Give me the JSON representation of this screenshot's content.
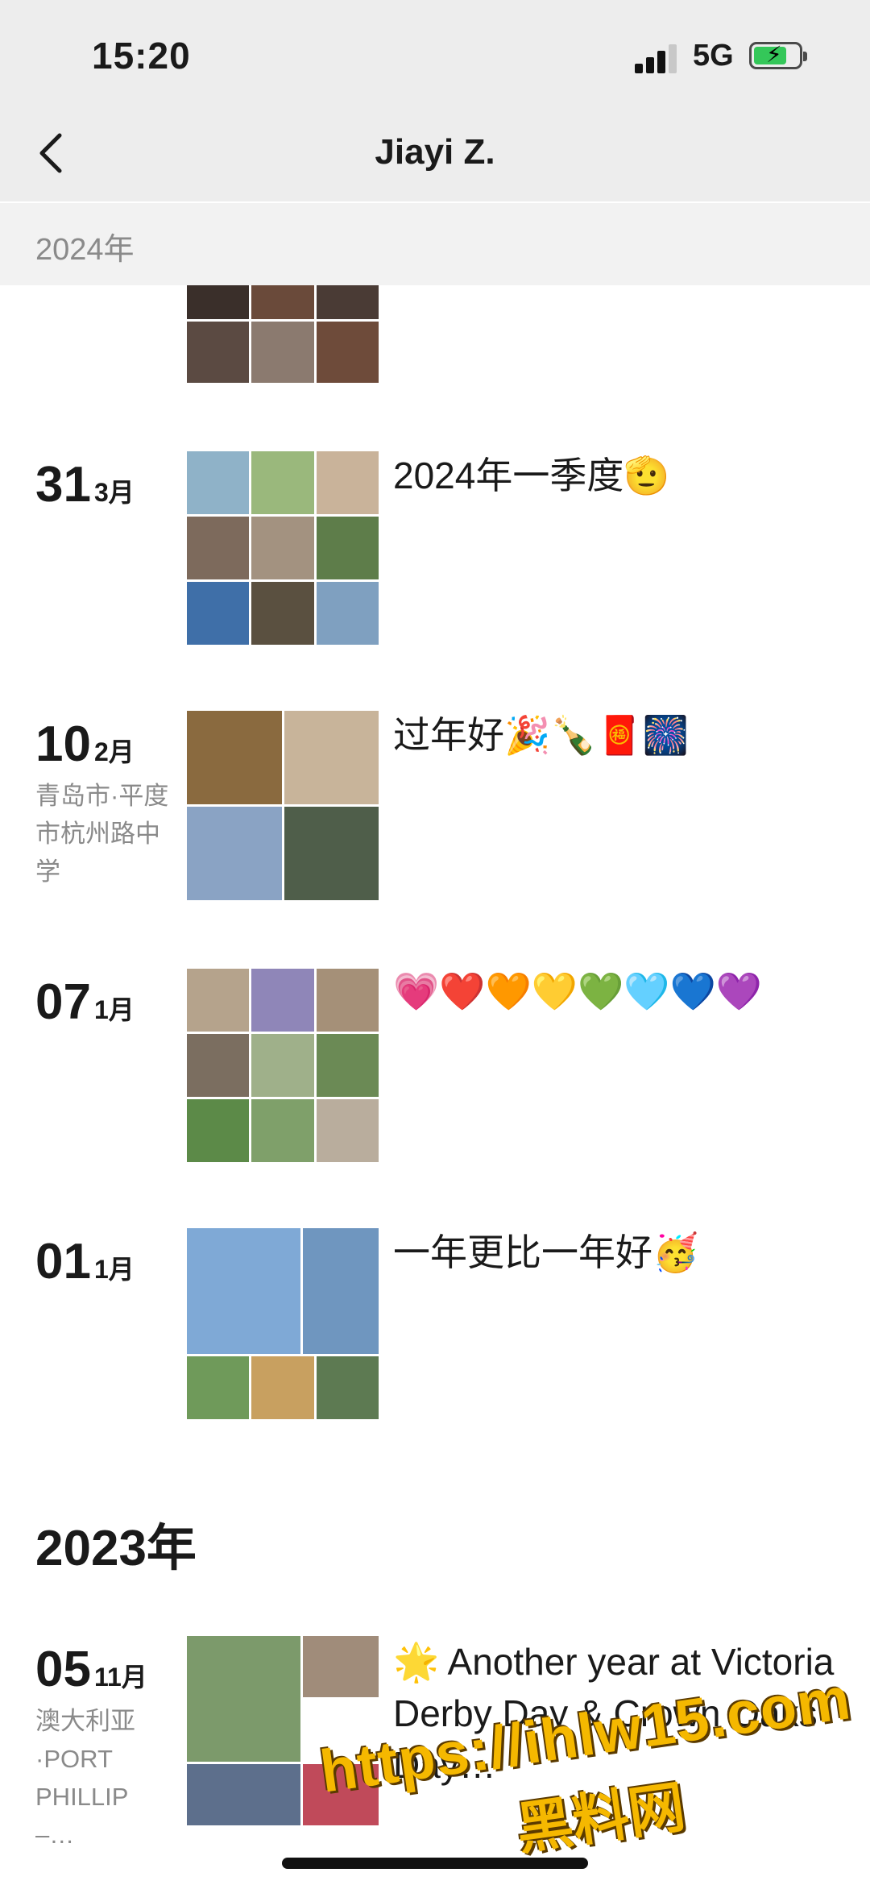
{
  "status": {
    "time": "15:20",
    "network": "5G"
  },
  "nav": {
    "title": "Jiayi Z."
  },
  "sticky_year": "2024年",
  "posts": [
    {
      "day": "31",
      "month": "3月",
      "caption": "2024年一季度🫡"
    },
    {
      "day": "10",
      "month": "2月",
      "location": "青岛市·平度市杭州路中学",
      "caption": "过年好🎉🍾🧧🎆"
    },
    {
      "day": "07",
      "month": "1月",
      "caption": "💗❤️🧡💛💚🩵💙💜"
    },
    {
      "day": "01",
      "month": "1月",
      "caption": "一年更比一年好🥳"
    },
    {
      "day": "05",
      "month": "11月",
      "location": "澳大利亚·PORT PHILLIP –…",
      "caption": "🌟 Another year at Victoria Derby Day & Crown Oaks Day…"
    }
  ],
  "year_2023": "2023年",
  "watermark": {
    "url": "https://ihlw15.com",
    "text": "黑料网"
  },
  "colors": {
    "accent_battery": "#34c759",
    "watermark": "#f5b800"
  }
}
